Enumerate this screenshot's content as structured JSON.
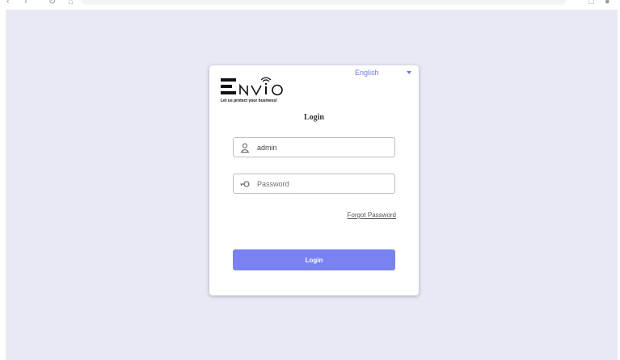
{
  "language": {
    "selected": "English"
  },
  "brand": {
    "logo_text": "ENVIO",
    "tagline": "Let us protect your business!"
  },
  "form": {
    "title": "Login",
    "username": {
      "value": "admin",
      "placeholder": ""
    },
    "password": {
      "value": "",
      "placeholder": "Password"
    },
    "forgot_label": "Forgot Password",
    "submit_label": "Login"
  },
  "colors": {
    "accent": "#7a82f0",
    "background": "#e7e9f4",
    "card": "#ffffff"
  },
  "icons": {
    "username": "user-icon",
    "password": "key-icon",
    "language": "chevron-down-icon"
  }
}
